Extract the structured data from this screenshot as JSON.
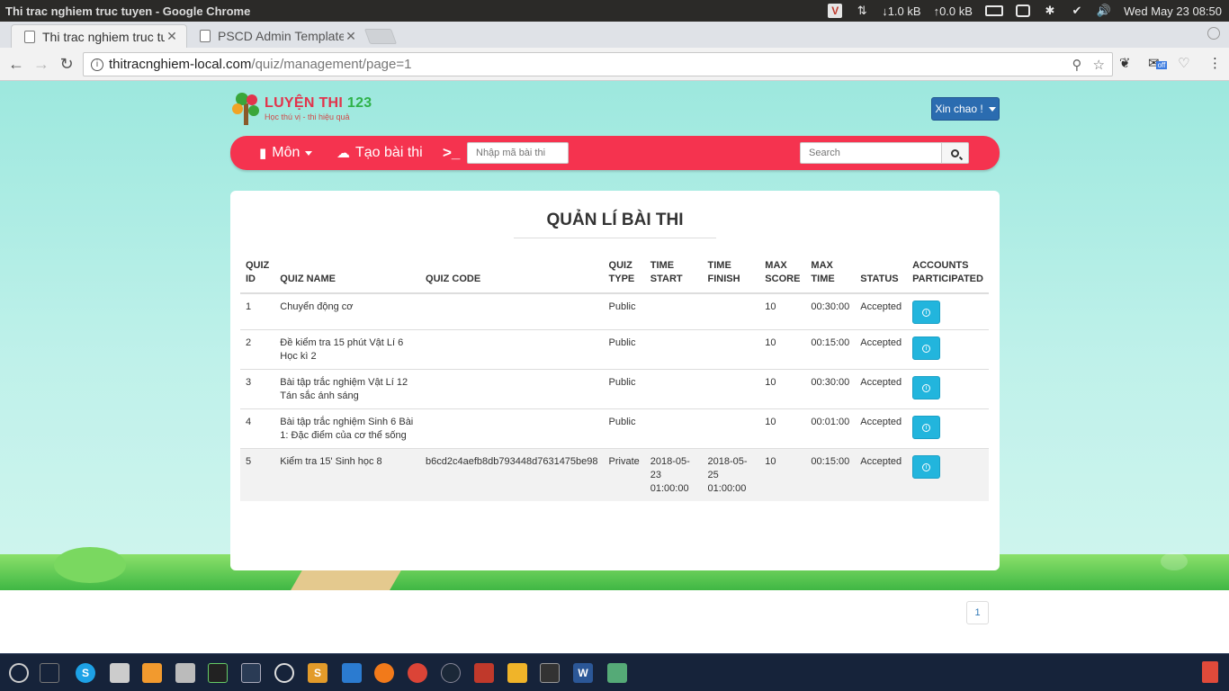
{
  "os_panel": {
    "window_title": "Thi trac nghiem truc tuyen - Google Chrome",
    "net_down": "↓1.0 kB",
    "net_up": "↑0.0 kB",
    "clock": "Wed May 23 08:50"
  },
  "browser": {
    "tabs": [
      {
        "label": "Thi trac nghiem truc tuyen"
      },
      {
        "label": "PSCD Admin Template"
      }
    ],
    "url_host": "thitracnghiem-local.com",
    "url_path": "/quiz/management/page=1",
    "extension_badge": "off"
  },
  "site": {
    "logo_name": "LUYỆN THI ",
    "logo_num": "123",
    "logo_tagline": "Học thú vị - thi hiệu quả",
    "greeting": "Xin chao !",
    "nav": {
      "subject": "Môn",
      "create_quiz": "Tạo bài thi",
      "terminal": ">_",
      "code_placeholder": "Nhập mã bài thi",
      "search_placeholder": "Search"
    }
  },
  "management": {
    "title": "QUẢN LÍ BÀI THI",
    "columns": [
      "QUIZ ID",
      "QUIZ NAME",
      "QUIZ CODE",
      "QUIZ TYPE",
      "TIME START",
      "TIME FINISH",
      "MAX SCORE",
      "MAX TIME",
      "STATUS",
      "ACCOUNTS PARTICIPATED"
    ],
    "rows": [
      {
        "id": "1",
        "name": "Chuyển động cơ",
        "code": "",
        "type": "Public",
        "start": "",
        "finish": "",
        "score": "10",
        "time": "00:30:00",
        "status": "Accepted"
      },
      {
        "id": "2",
        "name": "Đề kiểm tra 15 phút Vật Lí 6 Học kì 2",
        "code": "",
        "type": "Public",
        "start": "",
        "finish": "",
        "score": "10",
        "time": "00:15:00",
        "status": "Accepted"
      },
      {
        "id": "3",
        "name": "Bài tập trắc nghiệm Vật Lí 12 Tán sắc ánh sáng",
        "code": "",
        "type": "Public",
        "start": "",
        "finish": "",
        "score": "10",
        "time": "00:30:00",
        "status": "Accepted"
      },
      {
        "id": "4",
        "name": "Bài tập trắc nghiệm Sinh 6 Bài 1: Đặc điểm của cơ thể sống",
        "code": "",
        "type": "Public",
        "start": "",
        "finish": "",
        "score": "10",
        "time": "00:01:00",
        "status": "Accepted"
      },
      {
        "id": "5",
        "name": "Kiểm tra 15' Sinh học 8",
        "code": "b6cd2c4aefb8db793448d7631475be98",
        "type": "Private",
        "start": "2018-05-23 01:00:00",
        "finish": "2018-05-25 01:00:00",
        "score": "10",
        "time": "00:15:00",
        "status": "Accepted"
      }
    ],
    "pagination": [
      "1"
    ]
  },
  "taskbar": {
    "apps": [
      "dash",
      "workspaces",
      "skype",
      "files",
      "pdf-editor",
      "scanner",
      "system-monitor",
      "oscilloscope",
      "teamviewer",
      "sublime-text",
      "vscode",
      "firefox",
      "chrome",
      "steam",
      "filezilla",
      "virtualbox",
      "terminal",
      "word",
      "image-viewer"
    ]
  },
  "colors": {
    "navbar_red": "#f5334f",
    "button_blue": "#2b6cb0",
    "info_cyan": "#22b5dd",
    "background_mint": "#9de8de"
  }
}
